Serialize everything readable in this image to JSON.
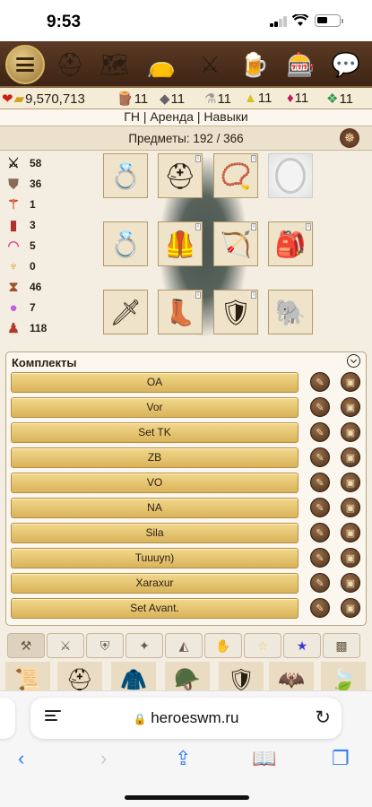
{
  "status_bar": {
    "time": "9:53"
  },
  "menu_icons": [
    "menu-icon",
    "helmet-icon",
    "map-icon",
    "bag-icon",
    "battle-icon",
    "tavern-icon",
    "casino-icon",
    "chat-icon"
  ],
  "resources": {
    "gold": "9,570,713",
    "wood": "11",
    "ore": "11",
    "mercury": "11",
    "sulfur": "11",
    "crystals": "11",
    "gems": "11"
  },
  "nav": {
    "gn": "ГН",
    "rent": "Аренда",
    "skills": "Навыки",
    "separator": "|"
  },
  "items_count": "Предметы: 192 / 366",
  "stats": [
    {
      "icon": "attack-icon",
      "value": "58"
    },
    {
      "icon": "defense-icon",
      "value": "36"
    },
    {
      "icon": "spellpower-icon",
      "value": "1"
    },
    {
      "icon": "knowledge-icon",
      "value": "3"
    },
    {
      "icon": "luck-icon",
      "value": "5"
    },
    {
      "icon": "morale-icon",
      "value": "0"
    },
    {
      "icon": "initiative-icon",
      "value": "46"
    },
    {
      "icon": "mana-icon",
      "value": "7"
    },
    {
      "icon": "units-icon",
      "value": "118"
    }
  ],
  "equipment": [
    "ring-icon",
    "helmet-icon",
    "amulet-icon",
    "mirror-slot-empty",
    "ring-icon",
    "armor-icon",
    "bow-icon",
    "backpack-icon",
    "sword-icon",
    "boots-icon",
    "shield-icon",
    "mount-icon"
  ],
  "sets": {
    "title": "Комплекты",
    "items": [
      "OA",
      "Vor",
      "Set TK",
      "ZB",
      "VO",
      "NA",
      "Sila",
      "Tuuuyn)",
      "Xaraxur",
      "Set Avant."
    ]
  },
  "inventory_tabs": [
    "all-icon",
    "weapons-icon",
    "armor-icon",
    "magic-icon",
    "accessories-icon",
    "misc-icon",
    "star-icon",
    "favorite-icon",
    "box-icon"
  ],
  "browser": {
    "url": "heroeswm.ru"
  }
}
